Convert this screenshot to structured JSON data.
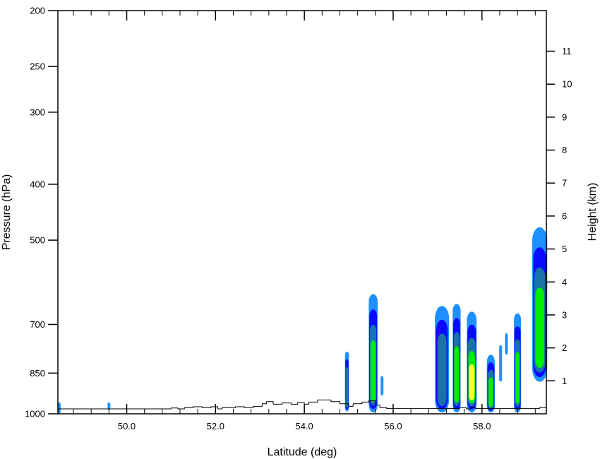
{
  "chart_data": {
    "type": "contour",
    "xlabel": "Latitude (deg)",
    "ylabel_left": "Pressure (hPa)",
    "ylabel_right": "Height (km)",
    "xlim": [
      48.45,
      59.45
    ],
    "ylim_pressure": [
      1000,
      200
    ],
    "y_scale": "log",
    "x_ticks": [
      {
        "value": 50.0,
        "label": "50.0"
      },
      {
        "value": 52.0,
        "label": "52.0"
      },
      {
        "value": 54.0,
        "label": "54.0"
      },
      {
        "value": 56.0,
        "label": "56.0"
      },
      {
        "value": 58.0,
        "label": "58.0"
      }
    ],
    "x_minor_step": 0.4,
    "pressure_ticks": [
      {
        "value": 200,
        "label": "200"
      },
      {
        "value": 250,
        "label": "250"
      },
      {
        "value": 300,
        "label": "300"
      },
      {
        "value": 400,
        "label": "400"
      },
      {
        "value": 500,
        "label": "500"
      },
      {
        "value": 700,
        "label": "700"
      },
      {
        "value": 850,
        "label": "850"
      },
      {
        "value": 1000,
        "label": "1000"
      }
    ],
    "height_ticks": [
      {
        "value": 1,
        "label": "1"
      },
      {
        "value": 2,
        "label": "2"
      },
      {
        "value": 3,
        "label": "3"
      },
      {
        "value": 4,
        "label": "4"
      },
      {
        "value": 5,
        "label": "5"
      },
      {
        "value": 6,
        "label": "6"
      },
      {
        "value": 7,
        "label": "7"
      },
      {
        "value": 8,
        "label": "8"
      },
      {
        "value": 9,
        "label": "9"
      },
      {
        "value": 10,
        "label": "10"
      },
      {
        "value": 11,
        "label": "11"
      }
    ],
    "contour_colors": [
      "#1e90ff",
      "#0a0aff",
      "#1874a8",
      "#00ee00",
      "#ffff30"
    ],
    "cells": [
      {
        "lat": 48.48,
        "width": 0.06,
        "top_p": 955,
        "bottom_p": 1000,
        "levels": 1
      },
      {
        "lat": 49.6,
        "width": 0.05,
        "top_p": 955,
        "bottom_p": 985,
        "levels": 1
      },
      {
        "lat": 54.96,
        "width": 0.09,
        "top_p": 780,
        "bottom_p": 990,
        "levels": 3
      },
      {
        "lat": 55.55,
        "width": 0.2,
        "top_p": 620,
        "bottom_p": 995,
        "levels": 4
      },
      {
        "lat": 55.75,
        "width": 0.06,
        "top_p": 860,
        "bottom_p": 930,
        "levels": 1
      },
      {
        "lat": 57.1,
        "width": 0.32,
        "top_p": 650,
        "bottom_p": 995,
        "levels": 3
      },
      {
        "lat": 57.43,
        "width": 0.18,
        "top_p": 645,
        "bottom_p": 995,
        "levels": 4
      },
      {
        "lat": 57.77,
        "width": 0.22,
        "top_p": 665,
        "bottom_p": 995,
        "levels": 5
      },
      {
        "lat": 58.2,
        "width": 0.18,
        "top_p": 790,
        "bottom_p": 995,
        "levels": 4
      },
      {
        "lat": 58.42,
        "width": 0.04,
        "top_p": 760,
        "bottom_p": 880,
        "levels": 1
      },
      {
        "lat": 58.55,
        "width": 0.04,
        "top_p": 725,
        "bottom_p": 790,
        "levels": 1
      },
      {
        "lat": 58.8,
        "width": 0.16,
        "top_p": 670,
        "bottom_p": 995,
        "levels": 4
      },
      {
        "lat": 59.3,
        "width": 0.34,
        "top_p": 475,
        "bottom_p": 880,
        "levels": 4
      }
    ],
    "terrain_profile": [
      [
        48.45,
        0
      ],
      [
        51.0,
        0
      ],
      [
        51.0,
        2
      ],
      [
        51.15,
        2
      ],
      [
        51.15,
        0
      ],
      [
        51.3,
        0
      ],
      [
        51.3,
        3
      ],
      [
        51.5,
        3
      ],
      [
        51.5,
        5
      ],
      [
        51.7,
        5
      ],
      [
        51.7,
        3
      ],
      [
        51.9,
        3
      ],
      [
        51.9,
        5
      ],
      [
        52.05,
        5
      ],
      [
        52.05,
        0
      ],
      [
        52.15,
        0
      ],
      [
        52.15,
        3
      ],
      [
        52.45,
        3
      ],
      [
        52.45,
        5
      ],
      [
        52.65,
        5
      ],
      [
        52.65,
        3
      ],
      [
        52.85,
        3
      ],
      [
        52.85,
        6
      ],
      [
        53.05,
        6
      ],
      [
        53.05,
        12
      ],
      [
        53.15,
        12
      ],
      [
        53.15,
        17
      ],
      [
        53.3,
        17
      ],
      [
        53.3,
        11
      ],
      [
        53.5,
        11
      ],
      [
        53.5,
        14
      ],
      [
        53.7,
        14
      ],
      [
        53.7,
        11
      ],
      [
        53.85,
        11
      ],
      [
        53.85,
        15
      ],
      [
        54.0,
        15
      ],
      [
        54.0,
        11
      ],
      [
        54.1,
        11
      ],
      [
        54.1,
        16
      ],
      [
        54.3,
        16
      ],
      [
        54.3,
        21
      ],
      [
        54.6,
        21
      ],
      [
        54.6,
        17
      ],
      [
        54.8,
        17
      ],
      [
        54.8,
        12
      ],
      [
        55.0,
        12
      ],
      [
        55.0,
        6
      ],
      [
        55.1,
        6
      ],
      [
        55.1,
        12
      ],
      [
        55.3,
        12
      ],
      [
        55.3,
        16
      ],
      [
        55.45,
        16
      ],
      [
        55.45,
        19
      ],
      [
        55.6,
        19
      ],
      [
        55.6,
        9
      ],
      [
        55.7,
        9
      ],
      [
        55.7,
        3
      ],
      [
        55.85,
        3
      ],
      [
        55.85,
        1
      ],
      [
        57.5,
        1
      ],
      [
        57.5,
        3
      ],
      [
        57.65,
        3
      ],
      [
        57.65,
        0
      ],
      [
        57.75,
        0
      ],
      [
        57.75,
        3
      ],
      [
        57.85,
        3
      ],
      [
        57.85,
        1
      ],
      [
        59.3,
        1
      ],
      [
        59.3,
        3
      ],
      [
        59.45,
        3
      ]
    ]
  }
}
